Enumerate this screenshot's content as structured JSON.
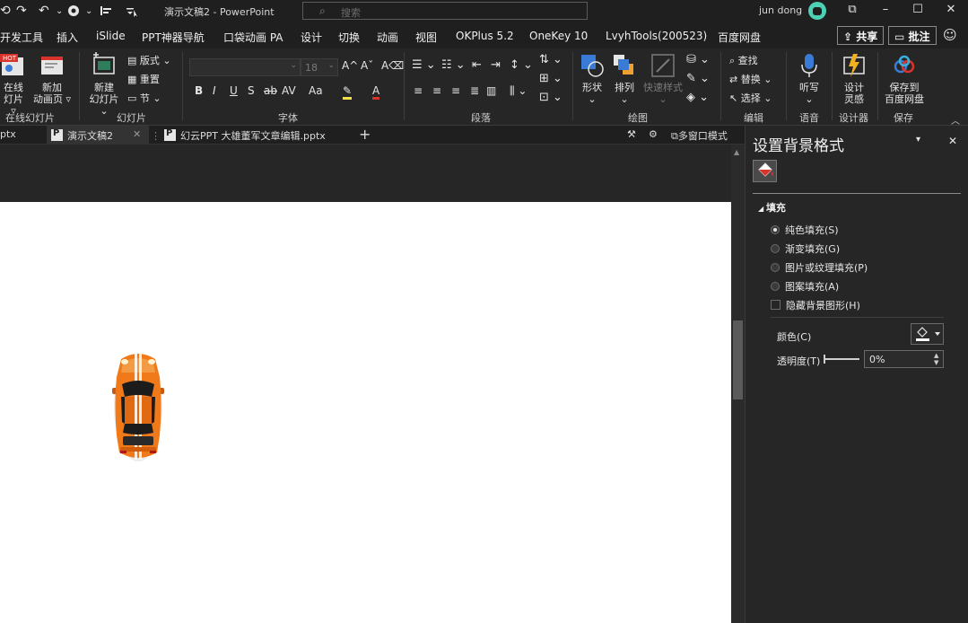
{
  "titlebar": {
    "doc_title": "演示文稿2  -  PowerPoint",
    "search_placeholder": "搜索",
    "user": "jun dong",
    "qat": {
      "autosave_glyph": "⟲",
      "redo_glyph": "↷",
      "undo_glyph": "↶",
      "chevron_glyph": "⌄"
    },
    "win": {
      "restore_glyph": "⧉",
      "minimize_glyph": "–",
      "maximize_glyph": "☐",
      "close_glyph": "✕"
    }
  },
  "ribbon_tabs": [
    "开发工具",
    "插入",
    "iSlide",
    "PPT神器导航",
    "口袋动画 PA",
    "设计",
    "切换",
    "动画",
    "视图",
    "OKPlus 5.2",
    "OneKey 10",
    "LvyhTools(200523)",
    "百度网盘"
  ],
  "ribbon_actions": {
    "share": "共享",
    "comment": "批注"
  },
  "ribbon": {
    "online": {
      "btn1": "在线",
      "btn1b": "灯片 ▿",
      "btn2": "新加",
      "btn2b": "动画页 ▿",
      "label": "在线幻灯片",
      "hot": "HOT"
    },
    "slides": {
      "new1": "新建",
      "new2": "幻灯片 ⌄",
      "layout": "版式 ⌄",
      "reset": "重置",
      "section": "节 ⌄",
      "label": "幻灯片"
    },
    "font": {
      "size": "18",
      "label": "字体",
      "bold": "B",
      "italic": "I",
      "underline": "U",
      "shadow": "S",
      "strike": "ab",
      "spacing": "AV",
      "case": "Aa",
      "grow": "A^",
      "shrink": "Aˇ",
      "clear": "A⌫",
      "highlight": "✎",
      "color": "A"
    },
    "paragraph": {
      "label": "段落"
    },
    "drawing": {
      "shape": "形状",
      "arrange": "排列",
      "quick": "快速样式",
      "label": "绘图"
    },
    "editing": {
      "find": "查找",
      "replace": "替换 ⌄",
      "select": "选择 ⌄",
      "label": "编辑"
    },
    "voice": {
      "dictate": "听写",
      "label": "语音"
    },
    "designer": {
      "btn1": "设计",
      "btn2": "灵感",
      "label": "设计器"
    },
    "save": {
      "btn1": "保存到",
      "btn2": "百度网盘",
      "label": "保存"
    }
  },
  "doc_tabs": [
    {
      "label": "ptx"
    },
    {
      "label": "演示文稿2"
    },
    {
      "label": "幻云PPT 大雄董军文章编辑.pptx"
    }
  ],
  "doc_tab_right": {
    "multiwin": "多窗口模式",
    "add": "+"
  },
  "pane": {
    "title": "设置背景格式",
    "section": "填充",
    "options": [
      {
        "label": "纯色填充(S)",
        "selected": true
      },
      {
        "label": "渐变填充(G)",
        "selected": false
      },
      {
        "label": "图片或纹理填充(P)",
        "selected": false
      },
      {
        "label": "图案填充(A)",
        "selected": false
      }
    ],
    "hide_bg_graphics": "隐藏背景图形(H)",
    "color_label": "颜色(C)",
    "transparency_label": "透明度(T)",
    "transparency_value": "0%"
  },
  "colors": {
    "accent_orange": "#f07a1a",
    "pane_bg": "#262626",
    "slide_bg": "#ffffff"
  }
}
